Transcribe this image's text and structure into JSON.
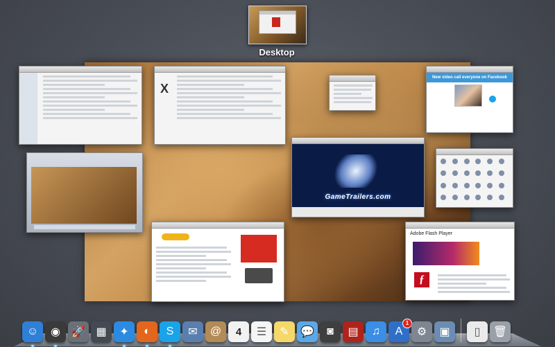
{
  "mission_control": {
    "space_label": "Desktop"
  },
  "windows": {
    "forum_x": "X",
    "facebook_banner": "New video call everyone on Facebook",
    "gametrailers_text": "GameTrailers.com",
    "flash_title": "Adobe Flash Player"
  },
  "dock": {
    "items": [
      {
        "name": "finder",
        "glyph": "☺",
        "color": "#2f7fd6",
        "running": true
      },
      {
        "name": "dashboard",
        "glyph": "◉",
        "color": "#3a3a3a",
        "running": true
      },
      {
        "name": "launchpad",
        "glyph": "🚀",
        "color": "#6a6f78",
        "running": false
      },
      {
        "name": "mission-control",
        "glyph": "▦",
        "color": "#444a52",
        "running": false
      },
      {
        "name": "safari",
        "glyph": "✦",
        "color": "#2c8be0",
        "running": true
      },
      {
        "name": "firefox",
        "glyph": "◐",
        "color": "#e3661d",
        "running": true
      },
      {
        "name": "skype",
        "glyph": "S",
        "color": "#1aa3e8",
        "running": true
      },
      {
        "name": "mail",
        "glyph": "✉",
        "color": "#5a7fae",
        "running": false
      },
      {
        "name": "address-book",
        "glyph": "@",
        "color": "#b38b57",
        "running": false
      },
      {
        "name": "ical",
        "glyph": "4",
        "color": "#f2f2f2",
        "running": false
      },
      {
        "name": "reminders",
        "glyph": "☰",
        "color": "#f5f5f5",
        "running": false
      },
      {
        "name": "notes",
        "glyph": "✎",
        "color": "#f4d86a",
        "running": false
      },
      {
        "name": "messages",
        "glyph": "💬",
        "color": "#5ba8e8",
        "running": false
      },
      {
        "name": "facetime",
        "glyph": "◙",
        "color": "#3f3f3f",
        "running": false
      },
      {
        "name": "photo-booth",
        "glyph": "▤",
        "color": "#b0231b",
        "running": false
      },
      {
        "name": "itunes",
        "glyph": "♫",
        "color": "#3a8ee6",
        "running": false
      },
      {
        "name": "app-store",
        "glyph": "A",
        "color": "#2f6fc7",
        "running": false,
        "badge": "1"
      },
      {
        "name": "system-preferences",
        "glyph": "⚙",
        "color": "#7d8691",
        "running": false
      },
      {
        "name": "preview",
        "glyph": "▣",
        "color": "#6b8cb3",
        "running": false
      }
    ],
    "right_items": [
      {
        "name": "document",
        "glyph": "▯",
        "color": "#eaeaea"
      },
      {
        "name": "trash",
        "glyph": "🗑",
        "color": "#9aa0a8"
      }
    ]
  }
}
